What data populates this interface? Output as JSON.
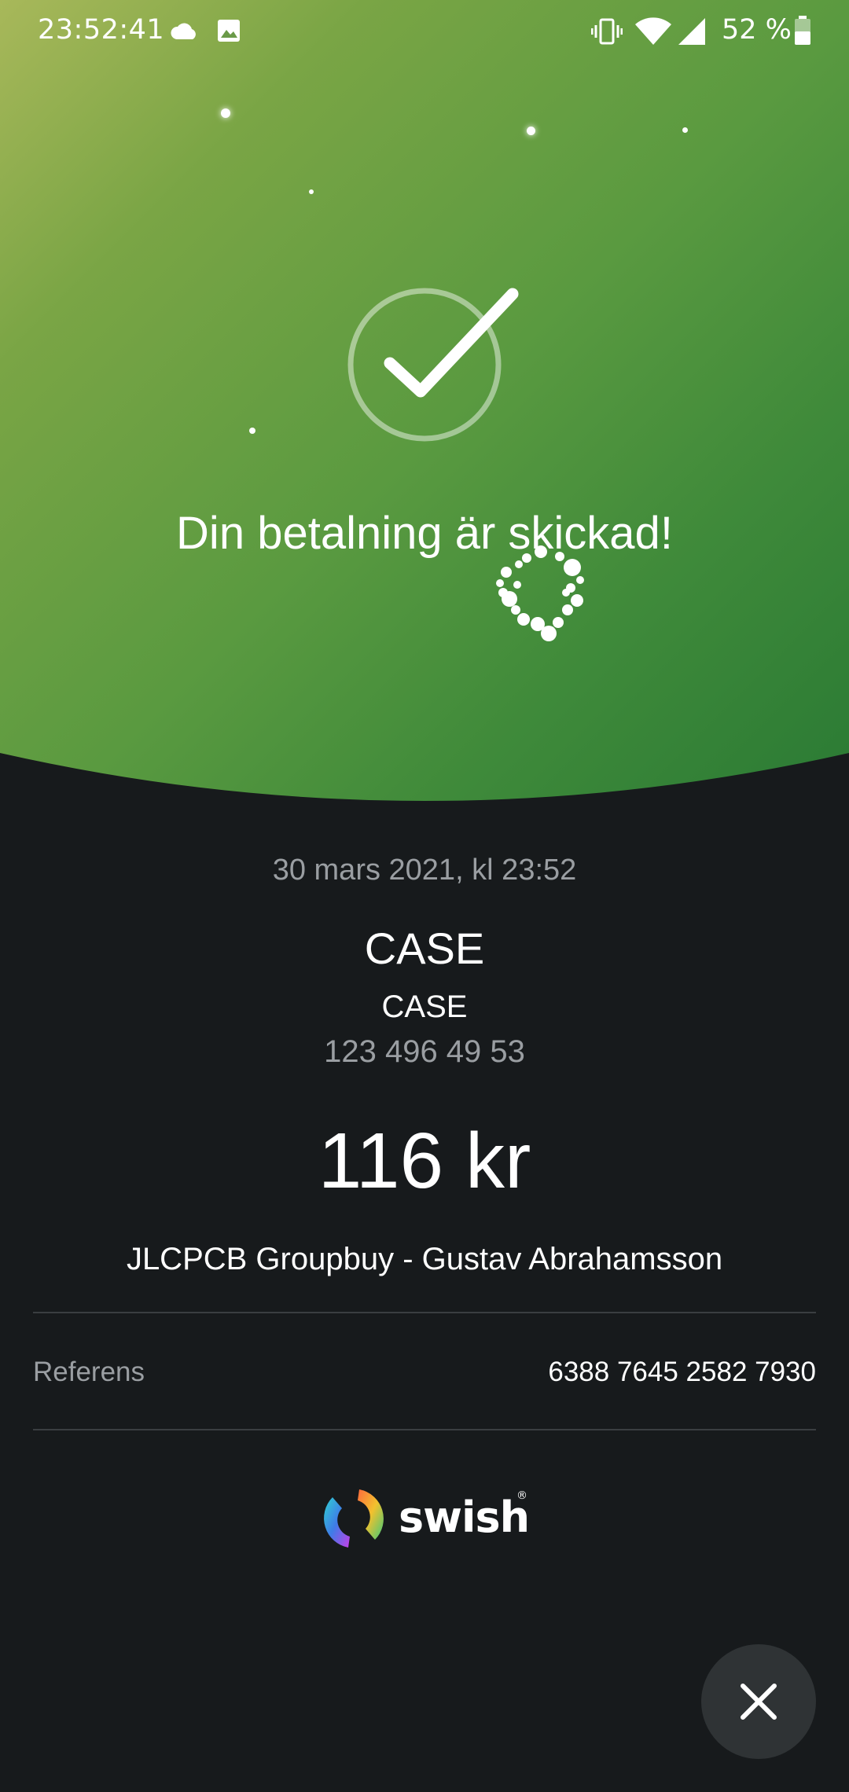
{
  "status_bar": {
    "time": "23:52:41",
    "battery_percent": "52 %",
    "icons": [
      "cloud-icon",
      "image-icon",
      "vibrate-icon",
      "wifi-icon",
      "signal-icon",
      "battery-icon"
    ]
  },
  "hero": {
    "title": "Din betalning är skickad!",
    "icon": "checkmark-circle-icon"
  },
  "payment": {
    "date": "30 mars 2021, kl 23:52",
    "recipient_name": "CASE",
    "recipient_subname": "CASE",
    "recipient_number": "123 496 49 53",
    "amount": "116 kr",
    "message": "JLCPCB Groupbuy - Gustav Abrahamsson",
    "reference_label": "Referens",
    "reference_value": "6388 7645 2582 7930"
  },
  "brand": {
    "logo_text": "swish",
    "registered_mark": "®"
  },
  "actions": {
    "close_icon": "close-icon"
  },
  "colors": {
    "background": "#171a1c",
    "hero_green_light": "#a8b85a",
    "hero_green_dark": "#2a7a34",
    "muted_text": "#9a9ea2",
    "divider": "#3a3e41",
    "fab": "#2f3335"
  }
}
